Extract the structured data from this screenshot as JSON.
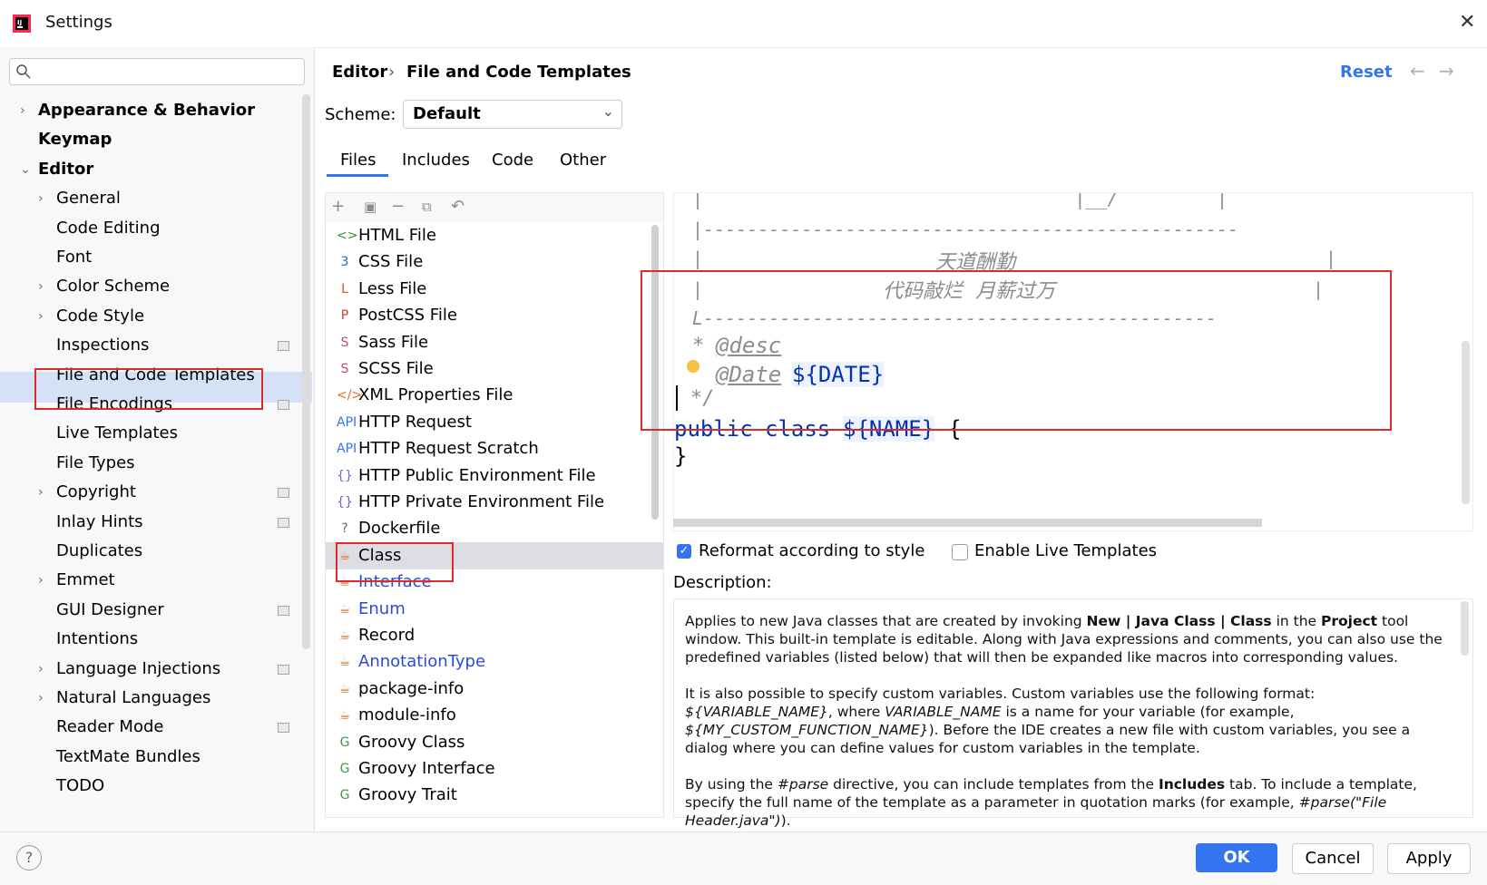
{
  "window": {
    "title": "Settings"
  },
  "search": {
    "placeholder": ""
  },
  "sidebar": {
    "items": [
      {
        "label": "Appearance & Behavior"
      },
      {
        "label": "Keymap"
      },
      {
        "label": "Editor"
      },
      {
        "label": "General"
      },
      {
        "label": "Code Editing"
      },
      {
        "label": "Font"
      },
      {
        "label": "Color Scheme"
      },
      {
        "label": "Code Style"
      },
      {
        "label": "Inspections"
      },
      {
        "label": "File and Code Templates"
      },
      {
        "label": "File Encodings"
      },
      {
        "label": "Live Templates"
      },
      {
        "label": "File Types"
      },
      {
        "label": "Copyright"
      },
      {
        "label": "Inlay Hints"
      },
      {
        "label": "Duplicates"
      },
      {
        "label": "Emmet"
      },
      {
        "label": "GUI Designer"
      },
      {
        "label": "Intentions"
      },
      {
        "label": "Language Injections"
      },
      {
        "label": "Natural Languages"
      },
      {
        "label": "Reader Mode"
      },
      {
        "label": "TextMate Bundles"
      },
      {
        "label": "TODO"
      }
    ]
  },
  "header": {
    "crumb_parent": "Editor",
    "crumb_sep": "›",
    "crumb_page": "File and Code Templates",
    "reset_label": "Reset",
    "back_icon": "←",
    "forward_icon": "→"
  },
  "scheme": {
    "label": "Scheme:",
    "value": "Default"
  },
  "tabs": [
    {
      "label": "Files"
    },
    {
      "label": "Includes"
    },
    {
      "label": "Code"
    },
    {
      "label": "Other"
    }
  ],
  "templates": [
    {
      "label": "HTML File",
      "icon": "<>",
      "color": "#3a8a3a"
    },
    {
      "label": "CSS File",
      "icon": "3",
      "color": "#2f5fd0"
    },
    {
      "label": "Less File",
      "icon": "L",
      "color": "#d0502f"
    },
    {
      "label": "PostCSS File",
      "icon": "P",
      "color": "#d0402f"
    },
    {
      "label": "Sass File",
      "icon": "S",
      "color": "#c04a7a"
    },
    {
      "label": "SCSS File",
      "icon": "S",
      "color": "#c04a7a"
    },
    {
      "label": "XML Properties File",
      "icon": "</>",
      "color": "#e07020"
    },
    {
      "label": "HTTP Request",
      "icon": "API",
      "color": "#3574f0"
    },
    {
      "label": "HTTP Request Scratch",
      "icon": "API",
      "color": "#3574f0"
    },
    {
      "label": "HTTP Public Environment File",
      "icon": "{}",
      "color": "#7a5cd0"
    },
    {
      "label": "HTTP Private Environment File",
      "icon": "{}",
      "color": "#7a5cd0"
    },
    {
      "label": "Dockerfile",
      "icon": "?",
      "color": "#666666"
    },
    {
      "label": "Class",
      "icon": "☕",
      "color": "#e07020"
    },
    {
      "label": "Interface",
      "icon": "☕",
      "color": "#e07020"
    },
    {
      "label": "Enum",
      "icon": "☕",
      "color": "#e07020"
    },
    {
      "label": "Record",
      "icon": "☕",
      "color": "#e07020"
    },
    {
      "label": "AnnotationType",
      "icon": "☕",
      "color": "#e07020"
    },
    {
      "label": "package-info",
      "icon": "☕",
      "color": "#e07020"
    },
    {
      "label": "module-info",
      "icon": "☕",
      "color": "#e07020"
    },
    {
      "label": "Groovy Class",
      "icon": "G",
      "color": "#3a9a4a"
    },
    {
      "label": "Groovy Interface",
      "icon": "G",
      "color": "#3a9a4a"
    },
    {
      "label": "Groovy Trait",
      "icon": "G",
      "color": "#3a9a4a"
    }
  ],
  "editor": {
    "line1": "|                                  |__/         |",
    "line2": "|-------------------------------------------------",
    "line3_a": "|",
    "line3_b": "天道酬勤",
    "line3_c": "|",
    "line4_a": "|",
    "line4_b": "代码敲烂  月薪过万",
    "line4_c": "|",
    "line5": "L-----------------------------------------------",
    "desc_star": "*",
    "desc_tag": "@desc",
    "date_tag": "@Date",
    "date_var": "${DATE}",
    "close_comment": "*/",
    "kw_public": "public",
    "kw_class": "class",
    "name_var": "${NAME}",
    "brace_open": "{",
    "brace_close": "}"
  },
  "options": {
    "reformat": "Reformat according to style",
    "live": "Enable Live Templates"
  },
  "description": {
    "label": "Description:",
    "p1_a": "Applies to new Java classes that are created by invoking ",
    "p1_b": "New | Java Class | Class",
    "p1_c": " in the ",
    "p1_d": "Project",
    "p1_e": " tool window. This built-in template is editable. Along with Java expressions and comments, you can also use the predefined variables (listed below) that will then be expanded like macros into corresponding values.",
    "p2_a": "It is also possible to specify custom variables. Custom variables use the following format: ",
    "p2_b": "${VARIABLE_NAME}",
    "p2_c": ", where ",
    "p2_d": "VARIABLE_NAME",
    "p2_e": " is a name for your variable (for example, ",
    "p2_f": "${MY_CUSTOM_FUNCTION_NAME}",
    "p2_g": "). Before the IDE creates a new file with custom variables, you see a dialog where you can define values for custom variables in the template.",
    "p3_a": "By using the ",
    "p3_b": "#parse",
    "p3_c": " directive, you can include templates from the ",
    "p3_d": "Includes",
    "p3_e": " tab. To include a template, specify the full name of the template as a parameter in quotation marks (for example, ",
    "p3_f": "#parse(\"File Header.java\")",
    "p3_g": ")."
  },
  "buttons": {
    "ok": "OK",
    "cancel": "Cancel",
    "apply": "Apply",
    "help": "?"
  },
  "colors": {
    "accent": "#3574f0",
    "highlight_box": "#e02a2a",
    "selection": "#d5e1f5",
    "keyword": "#0033b3"
  }
}
